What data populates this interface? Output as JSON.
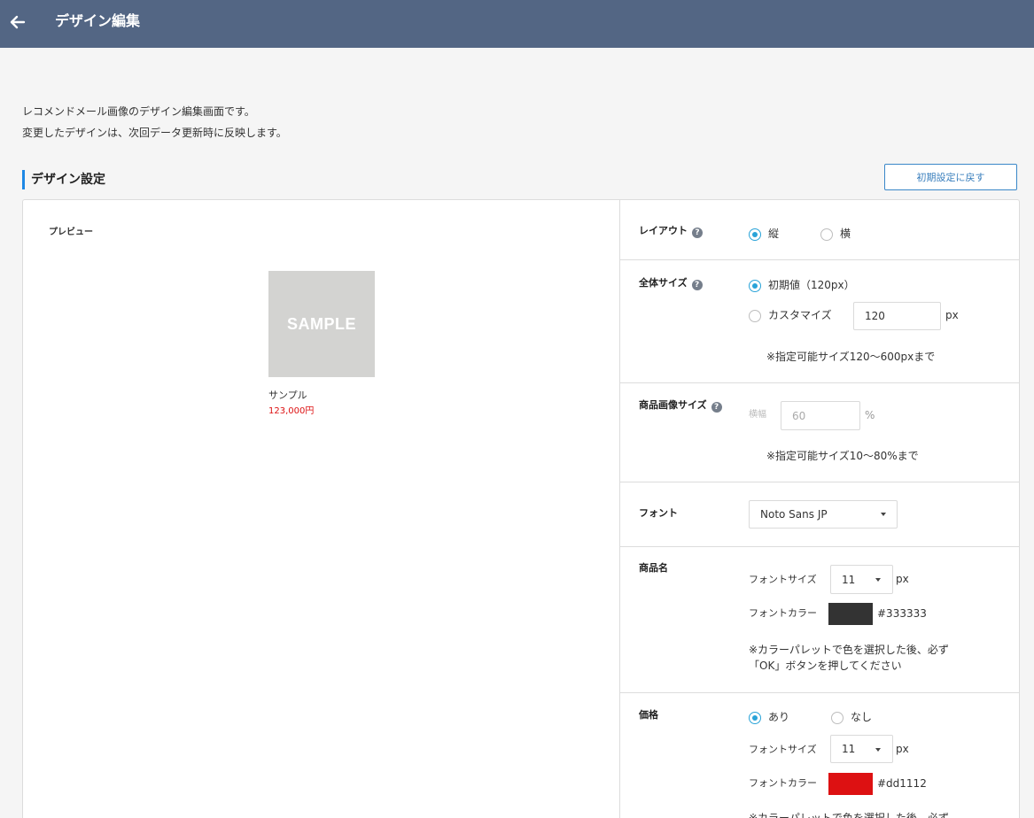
{
  "header": {
    "title": "デザイン編集",
    "back_icon": "arrow-left-icon"
  },
  "intro": {
    "line1": "レコメンドメール画像のデザイン編集画面です。",
    "line2": "変更したデザインは、次回データ更新時に反映します。"
  },
  "section": {
    "title": "デザイン設定",
    "reset_button": "初期設定に戻す"
  },
  "preview": {
    "label": "プレビュー",
    "image_text": "SAMPLE",
    "product_name": "サンプル",
    "product_price": "123,000円"
  },
  "settings": {
    "layout": {
      "label": "レイアウト",
      "options": [
        "縦",
        "横"
      ],
      "selected": "縦"
    },
    "total_size": {
      "label": "全体サイズ",
      "default_option": "初期値（120px）",
      "custom_option": "カスタマイズ",
      "custom_value": "120",
      "unit": "px",
      "note": "※指定可能サイズ120〜600pxまで"
    },
    "image_size": {
      "label": "商品画像サイズ",
      "field_label": "横幅",
      "value": "60",
      "unit": "%",
      "note": "※指定可能サイズ10〜80%まで"
    },
    "font": {
      "label": "フォント",
      "value": "Noto Sans JP"
    },
    "product_name": {
      "label": "商品名",
      "font_size_label": "フォントサイズ",
      "font_size": "11",
      "unit": "px",
      "font_color_label": "フォントカラー",
      "font_color": "#333333",
      "note_line1": "※カラーパレットで色を選択した後、必ず",
      "note_line2": "「OK」ボタンを押してください"
    },
    "price": {
      "label": "価格",
      "options": [
        "あり",
        "なし"
      ],
      "selected": "あり",
      "font_size_label": "フォントサイズ",
      "font_size": "11",
      "unit": "px",
      "font_color_label": "フォントカラー",
      "font_color": "#dd1112",
      "note_line1": "※カラーパレットで色を選択した後、必ず"
    }
  },
  "colors": {
    "header_bg": "#536684",
    "accent": "#1e88e5",
    "price": "#dd1112"
  }
}
